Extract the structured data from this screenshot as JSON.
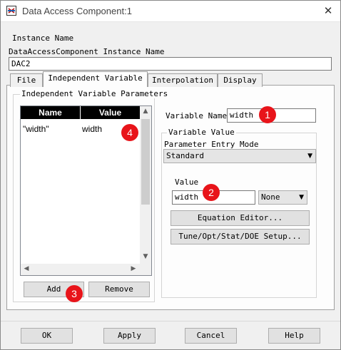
{
  "window": {
    "title": "Data Access Component:1",
    "close_glyph": "✕",
    "icon": "component-icon"
  },
  "instance": {
    "section_label": "Instance Name",
    "field_label": "DataAccessComponent Instance Name",
    "value": "DAC2"
  },
  "tabs": [
    {
      "label": "File"
    },
    {
      "label": "Independent Variable"
    },
    {
      "label": "Interpolation"
    },
    {
      "label": "Display"
    }
  ],
  "params_group": {
    "label": "Independent Variable Parameters"
  },
  "table": {
    "headers": [
      "Name",
      "Value"
    ],
    "rows": [
      {
        "name": "\"width\"",
        "value": "width"
      }
    ]
  },
  "buttons": {
    "add": "Add",
    "remove": "Remove"
  },
  "variable": {
    "name_label": "Variable Name",
    "name_value": "width",
    "group_label": "Variable Value",
    "entry_mode_label": "Parameter Entry Mode",
    "entry_mode_value": "Standard",
    "value_label": "Value",
    "value_value": "width",
    "unit_value": "None",
    "equation_editor": "Equation Editor...",
    "tune_setup": "Tune/Opt/Stat/DOE Setup..."
  },
  "footer": {
    "ok": "OK",
    "apply": "Apply",
    "cancel": "Cancel",
    "help": "Help"
  },
  "markers": [
    "1",
    "2",
    "3",
    "4"
  ],
  "colors": {
    "marker": "#e8141a",
    "header_bg": "#000000",
    "background": "#f0f0f0"
  }
}
